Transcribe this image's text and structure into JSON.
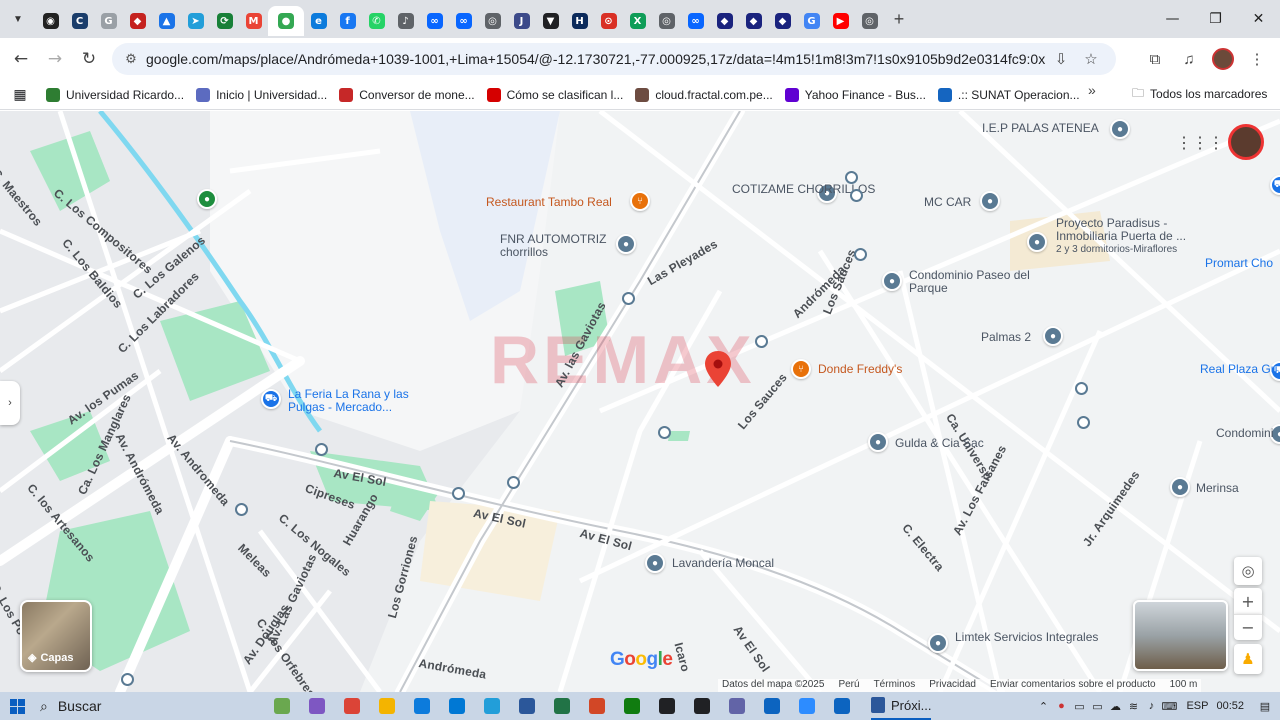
{
  "browser": {
    "tabs": [
      {
        "icon": "openai-icon",
        "color": "#222222",
        "glyph": "◉"
      },
      {
        "icon": "c-logo-icon",
        "color": "#1a3d6b",
        "glyph": "C"
      },
      {
        "icon": "generic-site-icon",
        "color": "#9aa0a6",
        "glyph": "G"
      },
      {
        "icon": "diamond-icon",
        "color": "#c5221f",
        "glyph": "◆"
      },
      {
        "icon": "stack-icon",
        "color": "#1a73e8",
        "glyph": "▲"
      },
      {
        "icon": "telegram-icon",
        "color": "#229ed9",
        "glyph": "➤"
      },
      {
        "icon": "exchange-icon",
        "color": "#188038",
        "glyph": "⟳"
      },
      {
        "icon": "gmail-icon",
        "color": "#ea4335",
        "glyph": "M"
      },
      {
        "icon": "maps-icon",
        "color": "#34a853",
        "glyph": "●",
        "active": true
      },
      {
        "icon": "edge-icon",
        "color": "#0c7bdc",
        "glyph": "e"
      },
      {
        "icon": "facebook-icon",
        "color": "#1877f2",
        "glyph": "f"
      },
      {
        "icon": "whatsapp-icon",
        "color": "#25d366",
        "glyph": "✆"
      },
      {
        "icon": "audio-icon",
        "color": "#5f6368",
        "glyph": "♪"
      },
      {
        "icon": "meta-icon",
        "color": "#0866ff",
        "glyph": "∞"
      },
      {
        "icon": "meta-icon",
        "color": "#0866ff",
        "glyph": "∞"
      },
      {
        "icon": "globe-icon",
        "color": "#5f6368",
        "glyph": "◎"
      },
      {
        "icon": "js-icon",
        "color": "#3c4a8a",
        "glyph": "J"
      },
      {
        "icon": "shield-icon",
        "color": "#202124",
        "glyph": "▼"
      },
      {
        "icon": "hacker-icon",
        "color": "#0b2a5b",
        "glyph": "H"
      },
      {
        "icon": "loop-icon",
        "color": "#d93025",
        "glyph": "⊙"
      },
      {
        "icon": "spreadsheet-icon",
        "color": "#0f9d58",
        "glyph": "X"
      },
      {
        "icon": "globe-icon",
        "color": "#5f6368",
        "glyph": "◎"
      },
      {
        "icon": "meta-icon",
        "color": "#0866ff",
        "glyph": "∞"
      },
      {
        "icon": "shield-icon",
        "color": "#1a237e",
        "glyph": "◆"
      },
      {
        "icon": "shield-icon",
        "color": "#1a237e",
        "glyph": "◆"
      },
      {
        "icon": "shield-icon",
        "color": "#1a237e",
        "glyph": "◆"
      },
      {
        "icon": "google-icon",
        "color": "#4285f4",
        "glyph": "G"
      },
      {
        "icon": "youtube-icon",
        "color": "#ff0000",
        "glyph": "▶"
      },
      {
        "icon": "globe-icon",
        "color": "#5f6368",
        "glyph": "◎"
      }
    ],
    "url": "google.com/maps/place/Andrómeda+1039-1001,+Lima+15054/@-12.1730721,-77.000925,17z/data=!4m15!1m8!3m7!1s0x9105b9d2e0314fc9:0x78a024a...",
    "bookmarks": [
      {
        "label": "Universidad Ricardo...",
        "icon": "university-icon",
        "color": "#2e7d32"
      },
      {
        "label": "Inicio | Universidad...",
        "icon": "globe-icon",
        "color": "#5c6bc0"
      },
      {
        "label": "Conversor de mone...",
        "icon": "car-icon",
        "color": "#c62828"
      },
      {
        "label": "Cómo se clasifican l...",
        "icon": "c-logo-icon",
        "color": "#d50000"
      },
      {
        "label": "cloud.fractal.com.pe...",
        "icon": "person-icon",
        "color": "#6d4c41"
      },
      {
        "label": "Yahoo Finance - Bus...",
        "icon": "yahoo-icon",
        "color": "#6001d2"
      },
      {
        "label": ".:: SUNAT Operacion...",
        "icon": "sunat-icon",
        "color": "#1565c0"
      }
    ],
    "all_bookmarks_label": "Todos los marcadores"
  },
  "map": {
    "watermark": "REMAX",
    "layers_label": "Capas",
    "google_logo": "Google",
    "attribution": [
      "Datos del mapa ©2025",
      "Perú",
      "Términos",
      "Privacidad",
      "Enviar comentarios sobre el producto",
      "100 m"
    ],
    "places": [
      {
        "name": "I.E.P PALAS ATENEA",
        "type": "school",
        "color": "#5a7a93"
      },
      {
        "name": "Restaurant Tambo Real",
        "type": "restaurant",
        "color": "#e8710a"
      },
      {
        "name": "COTIZAME CHORRILLOS",
        "type": "business",
        "color": "#5a7a93"
      },
      {
        "name": "MC CAR",
        "type": "business",
        "color": "#5a7a93"
      },
      {
        "name": "FNR AUTOMOTRIZ chorrillos",
        "type": "business",
        "color": "#5a7a93"
      },
      {
        "name": "Proyecto Paradisus - Inmobiliaria Puerta de ...",
        "subtitle": "2 y 3 dormitorios-Miraflores",
        "type": "real-estate",
        "color": "#5a7a93"
      },
      {
        "name": "Promart Cho",
        "type": "store",
        "color": "#1a73e8"
      },
      {
        "name": "Condominio Paseo del Parque",
        "type": "residential",
        "color": "#5a7a93"
      },
      {
        "name": "Palmas 2",
        "type": "residential",
        "color": "#5a7a93"
      },
      {
        "name": "Real Plaza Gu",
        "type": "mall",
        "color": "#1a73e8"
      },
      {
        "name": "Donde Freddy's",
        "type": "restaurant",
        "color": "#e8710a"
      },
      {
        "name": "La Feria La Rana y las Pulgas - Mercado...",
        "type": "market",
        "color": "#1a73e8"
      },
      {
        "name": "Gulda & Cia Sac",
        "type": "business",
        "color": "#5a7a93"
      },
      {
        "name": "Condomini",
        "type": "residential",
        "color": "#5a7a93"
      },
      {
        "name": "Merinsa",
        "type": "business",
        "color": "#5a7a93"
      },
      {
        "name": "Lavandería Moncal",
        "type": "laundry",
        "color": "#5a7a93"
      },
      {
        "name": "Limtek Servicios Integrales",
        "type": "business",
        "color": "#5a7a93"
      }
    ],
    "streets": [
      "Las Pleyades",
      "Andrómeda",
      "Av. las Gaviotas",
      "Los Sauces",
      "Ca. Universo",
      "Av El Sol",
      "Av El Sol",
      "Av El Sol",
      "Av El Sol",
      "Cipreses",
      "C. Electra",
      "Av. Los Faisanes",
      "Jr. Arquimedes",
      "Av. Andrómeda",
      "Av. los Pumas",
      "C. Los Galenos",
      "C. Los Labradores",
      "C. Los Baldios",
      "C. Los Compositores",
      "C. Maestros",
      "C. los Artesanos",
      "Ca. Los Manglares",
      "C. Los Nogales",
      "Huarango",
      "Av. Las Gaviotas",
      "Los Gorriones",
      "Andrómeda",
      "Icaro",
      "C. Los Orfebres",
      "Meleas",
      "Av. Douglas",
      "C. Los Poetas",
      "Los Sauces",
      "Av. Andromeda"
    ]
  },
  "taskbar": {
    "search_placeholder": "Buscar",
    "apps": [
      {
        "icon": "landscape-icon",
        "color": "#6aa84f"
      },
      {
        "icon": "copilot-icon",
        "color": "#7e57c2"
      },
      {
        "icon": "chrome-icon",
        "color": "#db4437"
      },
      {
        "icon": "folder-icon",
        "color": "#f4b400"
      },
      {
        "icon": "edge-icon",
        "color": "#0c7bdc"
      },
      {
        "icon": "outlook-icon",
        "color": "#0078d4"
      },
      {
        "icon": "telegram-icon",
        "color": "#229ed9"
      },
      {
        "icon": "word-icon",
        "color": "#2b579a"
      },
      {
        "icon": "excel-icon",
        "color": "#217346"
      },
      {
        "icon": "powerpoint-icon",
        "color": "#d24726"
      },
      {
        "icon": "calculator-icon",
        "color": "#107c10"
      },
      {
        "icon": "media-icon",
        "color": "#202124"
      },
      {
        "icon": "chatgpt-icon",
        "color": "#202124"
      },
      {
        "icon": "chat-icon",
        "color": "#6264a7"
      },
      {
        "icon": "vpn-icon",
        "color": "#0c64c0"
      },
      {
        "icon": "zoom-icon",
        "color": "#2d8cff"
      },
      {
        "icon": "photos-icon",
        "color": "#0c64c0"
      }
    ],
    "active_window": "Próxi...",
    "language": "ESP",
    "time": "00:52"
  }
}
